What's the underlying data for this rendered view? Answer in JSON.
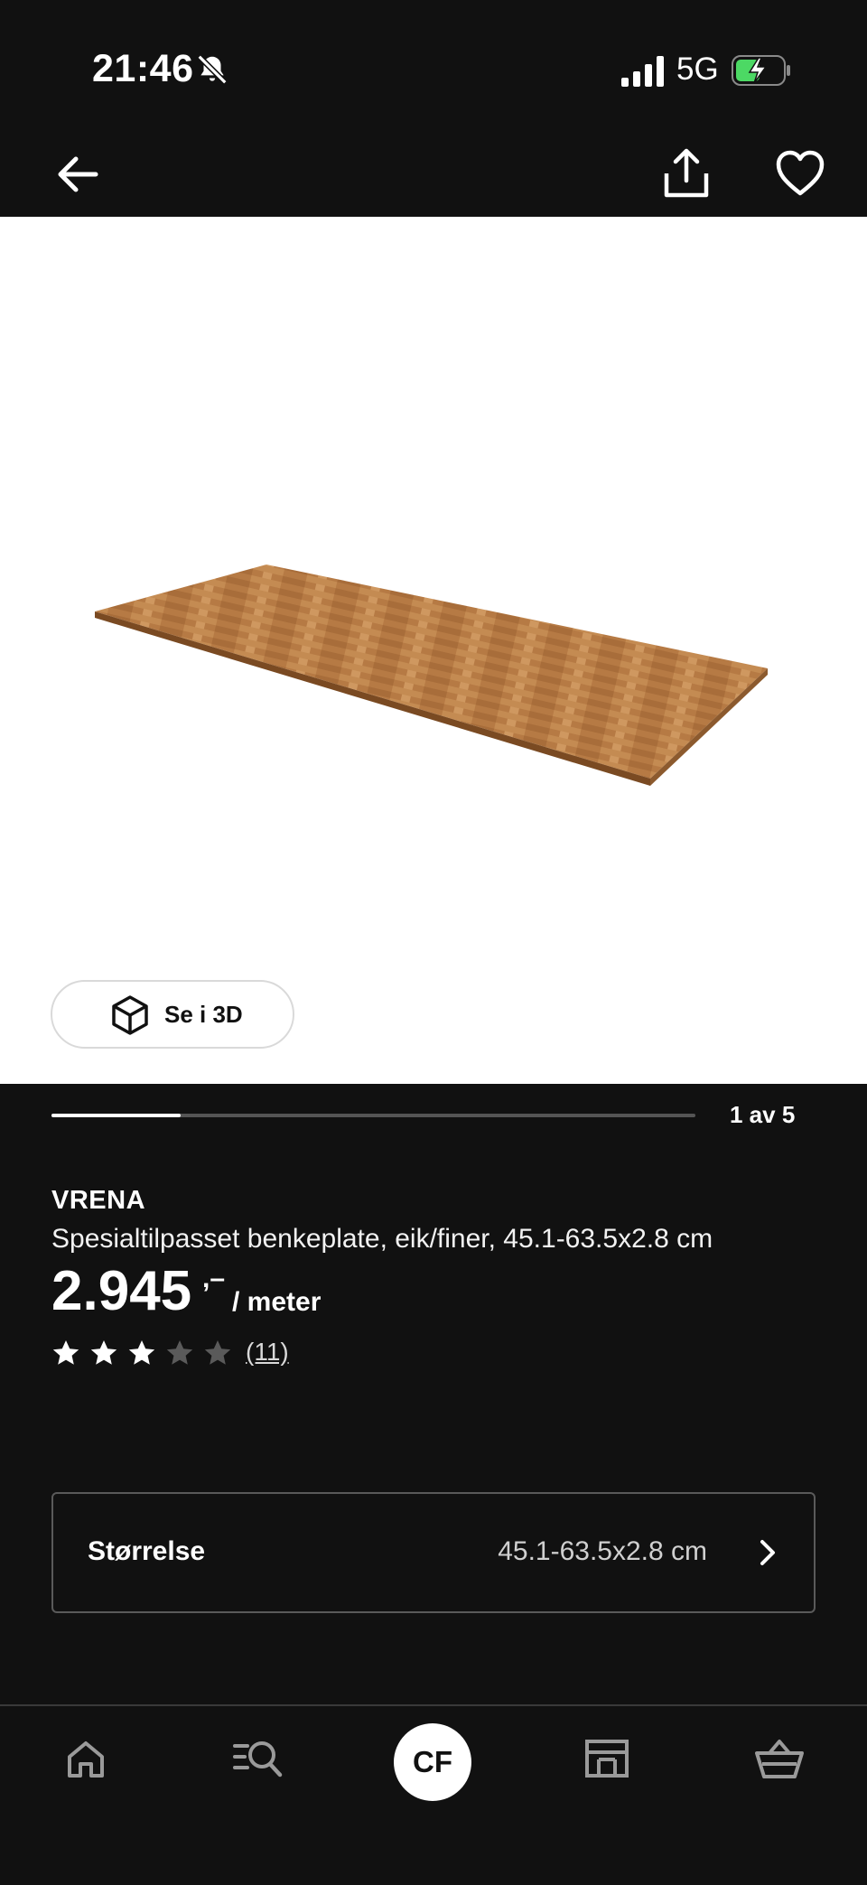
{
  "status_bar": {
    "time": "21:46",
    "network": "5G"
  },
  "colors": {
    "background": "#111111",
    "image_background": "#ffffff",
    "star_filled": "#ffffff",
    "star_empty": "#5a5a5a"
  },
  "icons": {
    "back": "arrow-left-icon",
    "share": "share-icon",
    "favorite": "heart-icon",
    "view_3d": "cube-icon",
    "size_chevron": "chevron-right-icon",
    "tabs": [
      "home-icon",
      "search-icon",
      "profile-avatar",
      "store-icon",
      "cart-icon"
    ]
  },
  "gallery": {
    "view_3d_label": "Se i 3D",
    "counter": "1 av 5",
    "progress": 0.2
  },
  "product": {
    "name": "VRENA",
    "description": "Spesialtilpasset benkeplate, eik/finer, 45.1-63.5x2.8 cm",
    "price_main": "2.945",
    "price_suffix": ",–",
    "price_unit": "/ meter",
    "rating": 3,
    "rating_max": 5,
    "review_count": "(11)"
  },
  "size_selector": {
    "label": "Størrelse",
    "value": "45.1-63.5x2.8 cm"
  },
  "bottom_nav": {
    "profile_initials": "CF"
  }
}
